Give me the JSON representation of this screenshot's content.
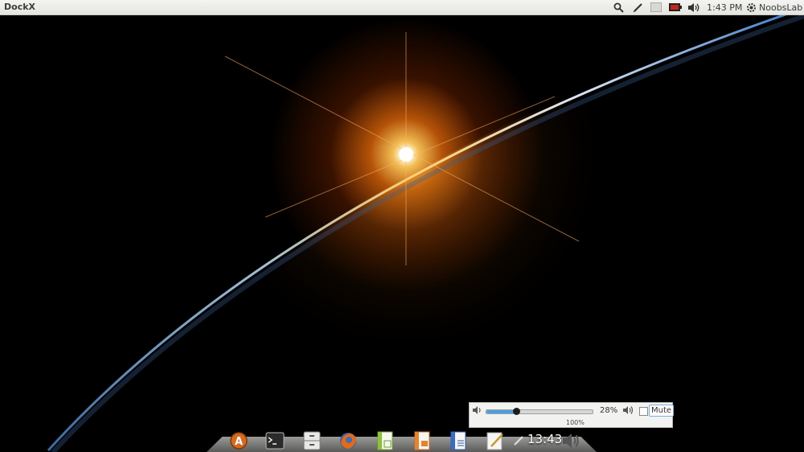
{
  "topbar": {
    "app_title": "DockX",
    "clock": "1:43 PM",
    "user_name": "NoobsLab",
    "icons": [
      "search-icon",
      "pen-icon",
      "keyboard-layout-icon",
      "battery-icon",
      "volume-icon"
    ]
  },
  "volume_popup": {
    "level": 0.28,
    "percent_label": "28%",
    "max_label": "100%",
    "mute_label": "Mute",
    "mute_checked": false
  },
  "dock": {
    "apps": [
      "software-center-icon",
      "terminal-icon",
      "file-manager-icon",
      "firefox-icon",
      "calc-icon",
      "impress-icon",
      "writer-icon",
      "text-editor-icon"
    ],
    "clock": "13:43",
    "tray_icons": [
      "pen-icon",
      "volume-icon"
    ]
  },
  "colors": {
    "accent": "#4aa0e0",
    "topbar_bg": "#ececea",
    "dock_bg": "#7a7a78"
  }
}
